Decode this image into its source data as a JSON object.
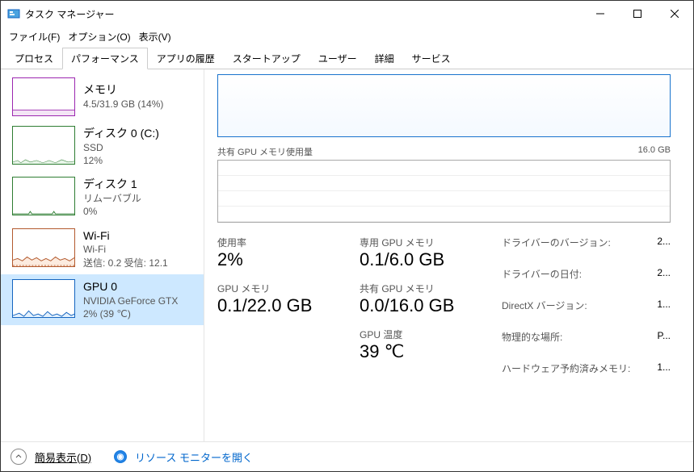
{
  "window": {
    "title": "タスク マネージャー"
  },
  "menu": {
    "file": "ファイル(F)",
    "options": "オプション(O)",
    "view": "表示(V)"
  },
  "tabs": [
    "プロセス",
    "パフォーマンス",
    "アプリの履歴",
    "スタートアップ",
    "ユーザー",
    "詳細",
    "サービス"
  ],
  "active_tab": 1,
  "sidebar": [
    {
      "title": "メモリ",
      "sub1": "4.5/31.9 GB (14%)",
      "sub2": "",
      "color": "#9c27b0",
      "fill": "#f3e5f5"
    },
    {
      "title": "ディスク 0 (C:)",
      "sub1": "SSD",
      "sub2": "12%",
      "color": "#2e7d32",
      "fill": "#e8f5e9"
    },
    {
      "title": "ディスク 1",
      "sub1": "リムーバブル",
      "sub2": "0%",
      "color": "#2e7d32",
      "fill": "#e8f5e9"
    },
    {
      "title": "Wi-Fi",
      "sub1": "Wi-Fi",
      "sub2": "送信: 0.2 受信: 12.1",
      "color": "#b35a2e",
      "fill": "#fcebdf"
    },
    {
      "title": "GPU 0",
      "sub1": "NVIDIA GeForce GTX",
      "sub2": "2%  (39 ℃)",
      "color": "#1565c0",
      "fill": "#e3f1fd"
    }
  ],
  "selected_sidebar": 4,
  "main": {
    "shared_label": "共有 GPU メモリ使用量",
    "shared_max": "16.0 GB",
    "stats": [
      {
        "label": "使用率",
        "value": "2%"
      },
      {
        "label": "GPU メモリ",
        "value": "0.1/22.0 GB"
      }
    ],
    "stats2": [
      {
        "label": "専用 GPU メモリ",
        "value": "0.1/6.0 GB"
      },
      {
        "label": "共有 GPU メモリ",
        "value": "0.0/16.0 GB"
      },
      {
        "label": "GPU 温度",
        "value": "39 ℃"
      }
    ],
    "specs": [
      {
        "label": "ドライバーのバージョン:",
        "value": "2..."
      },
      {
        "label": "ドライバーの日付:",
        "value": "2..."
      },
      {
        "label": "DirectX バージョン:",
        "value": "1..."
      },
      {
        "label": "物理的な場所:",
        "value": "P..."
      },
      {
        "label": "ハードウェア予約済みメモリ:",
        "value": "1..."
      }
    ]
  },
  "footer": {
    "simple": "簡易表示(D)",
    "monitor": "リソース モニターを開く"
  },
  "chart_data": {
    "type": "line",
    "title": "共有 GPU メモリ使用量",
    "ylim": [
      0,
      16.0
    ],
    "ylabel": "GB",
    "values": "flat near zero"
  }
}
